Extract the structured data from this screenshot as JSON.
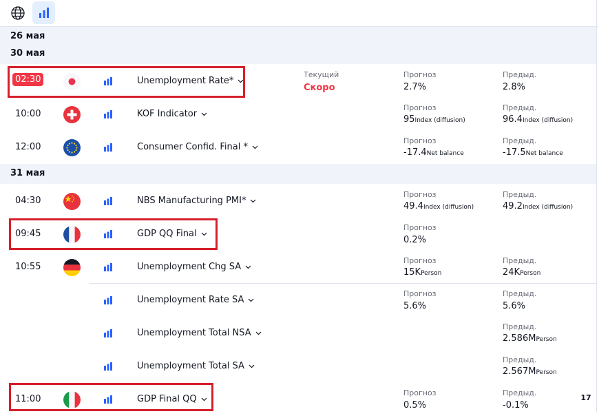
{
  "toolbar": {
    "buttons": [
      {
        "icon": "globe-icon",
        "active": false
      },
      {
        "icon": "bar-chart-icon",
        "active": true
      }
    ]
  },
  "dates": [
    "26 мая",
    "30 мая",
    "31 мая"
  ],
  "labels": {
    "forecast": "Прогноз",
    "previous": "Предыд.",
    "actual": "Текущий",
    "soon": "Скоро"
  },
  "events": [
    {
      "time": "02:30",
      "country": "japan",
      "name": "Unemployment Rate*",
      "actual_label": "Текущий",
      "status": "Скоро",
      "forecast": "2.7%",
      "forecast_unit": "",
      "previous": "2.8%",
      "previous_unit": ""
    },
    {
      "time": "10:00",
      "country": "switzerland",
      "name": "KOF Indicator",
      "forecast": "95",
      "forecast_unit": "Index (diffusion)",
      "previous": "96.4",
      "previous_unit": "Index (diffusion)"
    },
    {
      "time": "12:00",
      "country": "eu",
      "name": "Consumer Confid. Final *",
      "forecast": "-17.4",
      "forecast_unit": "Net balance",
      "previous": "-17.5",
      "previous_unit": "Net balance"
    },
    {
      "time": "04:30",
      "country": "china",
      "name": "NBS Manufacturing PMI*",
      "forecast": "49.4",
      "forecast_unit": "Index (diffusion)",
      "previous": "49.2",
      "previous_unit": "Index (diffusion)"
    },
    {
      "time": "09:45",
      "country": "france",
      "name": "GDP QQ Final",
      "forecast": "0.2%",
      "forecast_unit": ""
    },
    {
      "time": "10:55",
      "country": "germany",
      "name": "Unemployment Chg SA",
      "forecast": "15K",
      "forecast_unit": "Person",
      "previous": "24K",
      "previous_unit": "Person"
    },
    {
      "name": "Unemployment Rate SA",
      "forecast": "5.6%",
      "forecast_unit": "",
      "previous": "5.6%",
      "previous_unit": ""
    },
    {
      "name": "Unemployment Total NSA",
      "previous": "2.586M",
      "previous_unit": "Person"
    },
    {
      "name": "Unemployment Total SA",
      "previous": "2.567M",
      "previous_unit": "Person"
    },
    {
      "time": "11:00",
      "country": "italy",
      "name": "GDP Final QQ",
      "forecast": "0.5%",
      "forecast_unit": "",
      "previous": "-0.1%",
      "previous_unit": ""
    }
  ],
  "colors": {
    "accent": "#2962ff",
    "alert": "#f23645",
    "highlight": "#d61f2c"
  },
  "branding": {
    "logo": "17"
  }
}
